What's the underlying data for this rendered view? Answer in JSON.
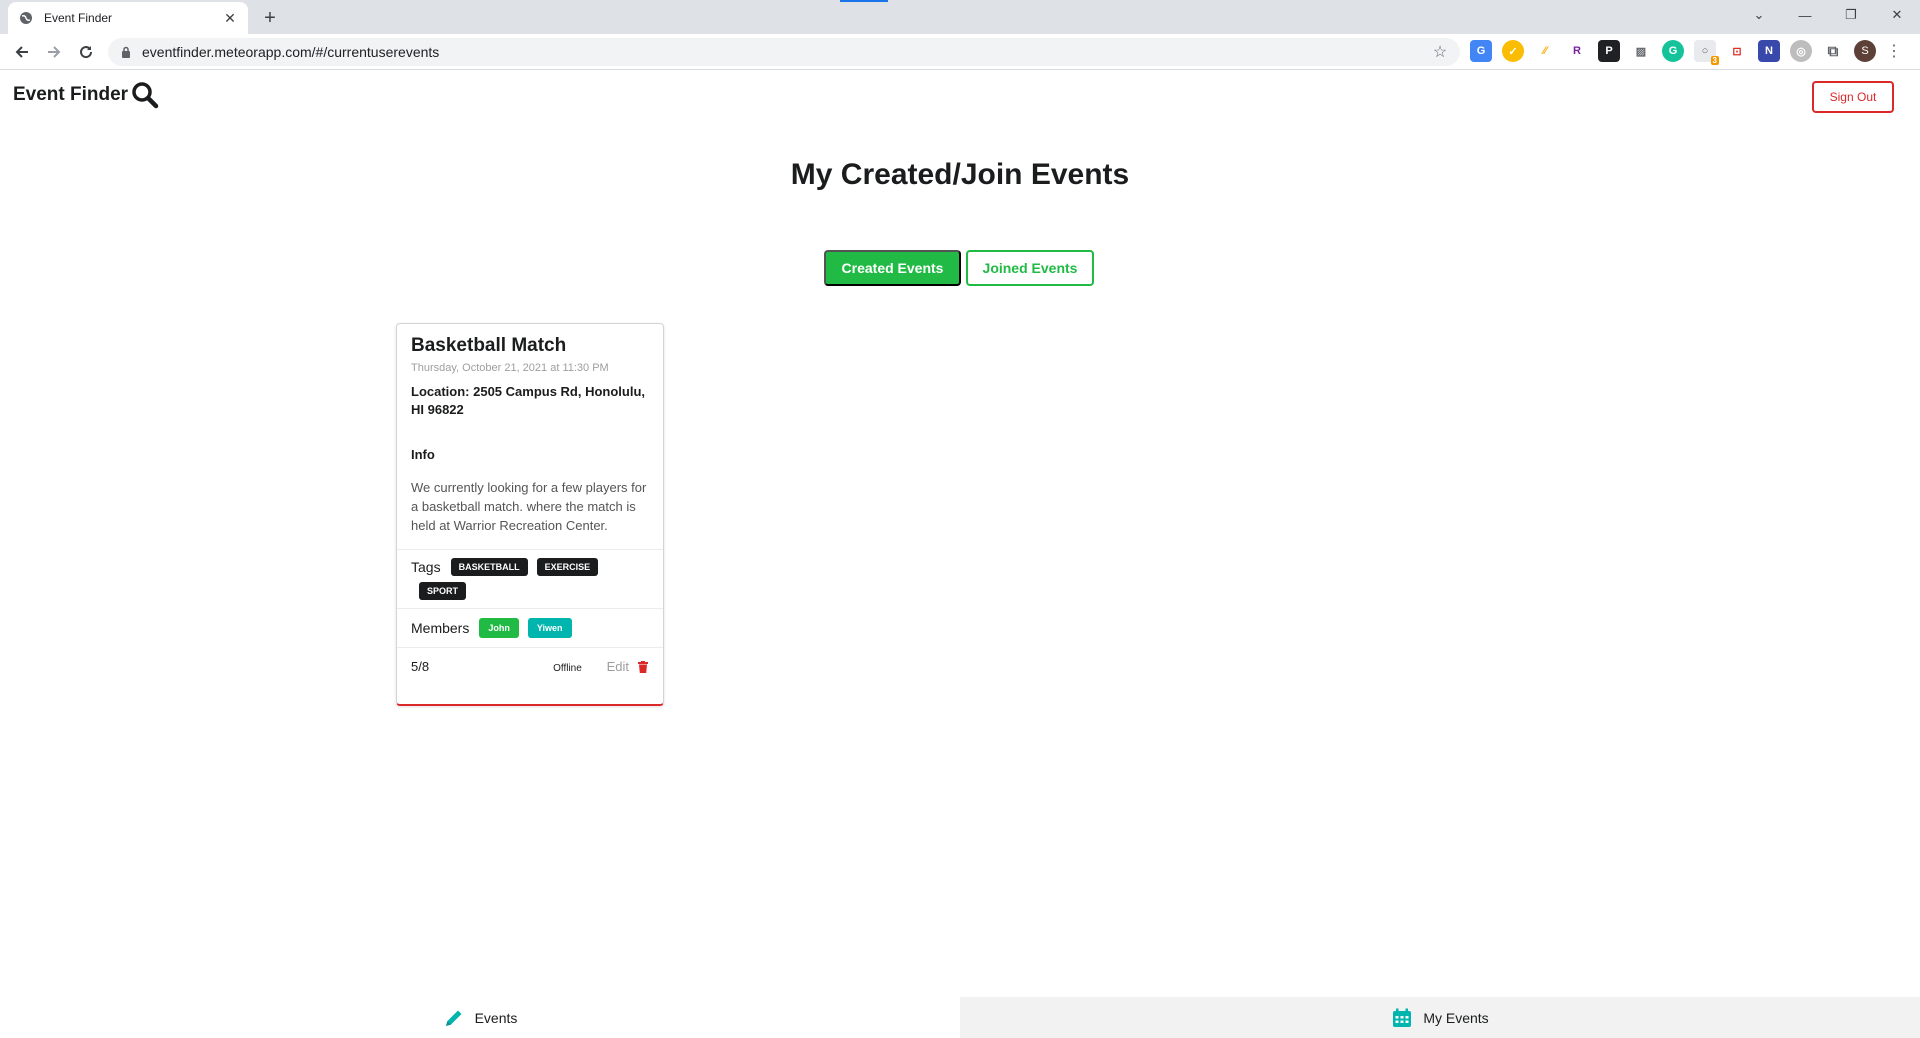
{
  "browser": {
    "tab_title": "Event Finder",
    "url": "eventfinder.meteorapp.com/#/currentuserevents",
    "profile_initial": "S",
    "extensions": [
      "google-translate-extension",
      "norton-extension",
      "pencil-extension",
      "r-extension",
      "p-extension",
      "photo-extension",
      "grammarly-extension",
      "badge-extension",
      "screenshot-extension",
      "vs-extension",
      "globe-extension",
      "puzzle-extension"
    ],
    "extension_badge": "3"
  },
  "app": {
    "brand": "Event Finder",
    "sign_out": "Sign Out",
    "page_title": "My Created/Join Events",
    "tabs": {
      "created": "Created Events",
      "joined": "Joined Events"
    },
    "colors": {
      "primary": "#21ba45",
      "danger": "#db2828",
      "teal": "#00b5ad",
      "dark": "#1b1c1d"
    }
  },
  "event": {
    "title": "Basketball Match",
    "datetime": "Thursday, October 21, 2021 at 11:30 PM",
    "location": "Location: 2505 Campus Rd, Honolulu, HI 96822",
    "info_heading": "Info",
    "description": "We currently looking for a few players for a basketball match. where the match is held at Warrior Recreation Center.",
    "tags_label": "Tags",
    "tags": [
      "BASKETBALL",
      "EXERCISE",
      "SPORT"
    ],
    "members_label": "Members",
    "members": [
      "John",
      "Yiwen"
    ],
    "count": "5/8",
    "mode": "Offline",
    "edit": "Edit"
  },
  "bottom_nav": {
    "events": "Events",
    "my_events": "My Events"
  }
}
